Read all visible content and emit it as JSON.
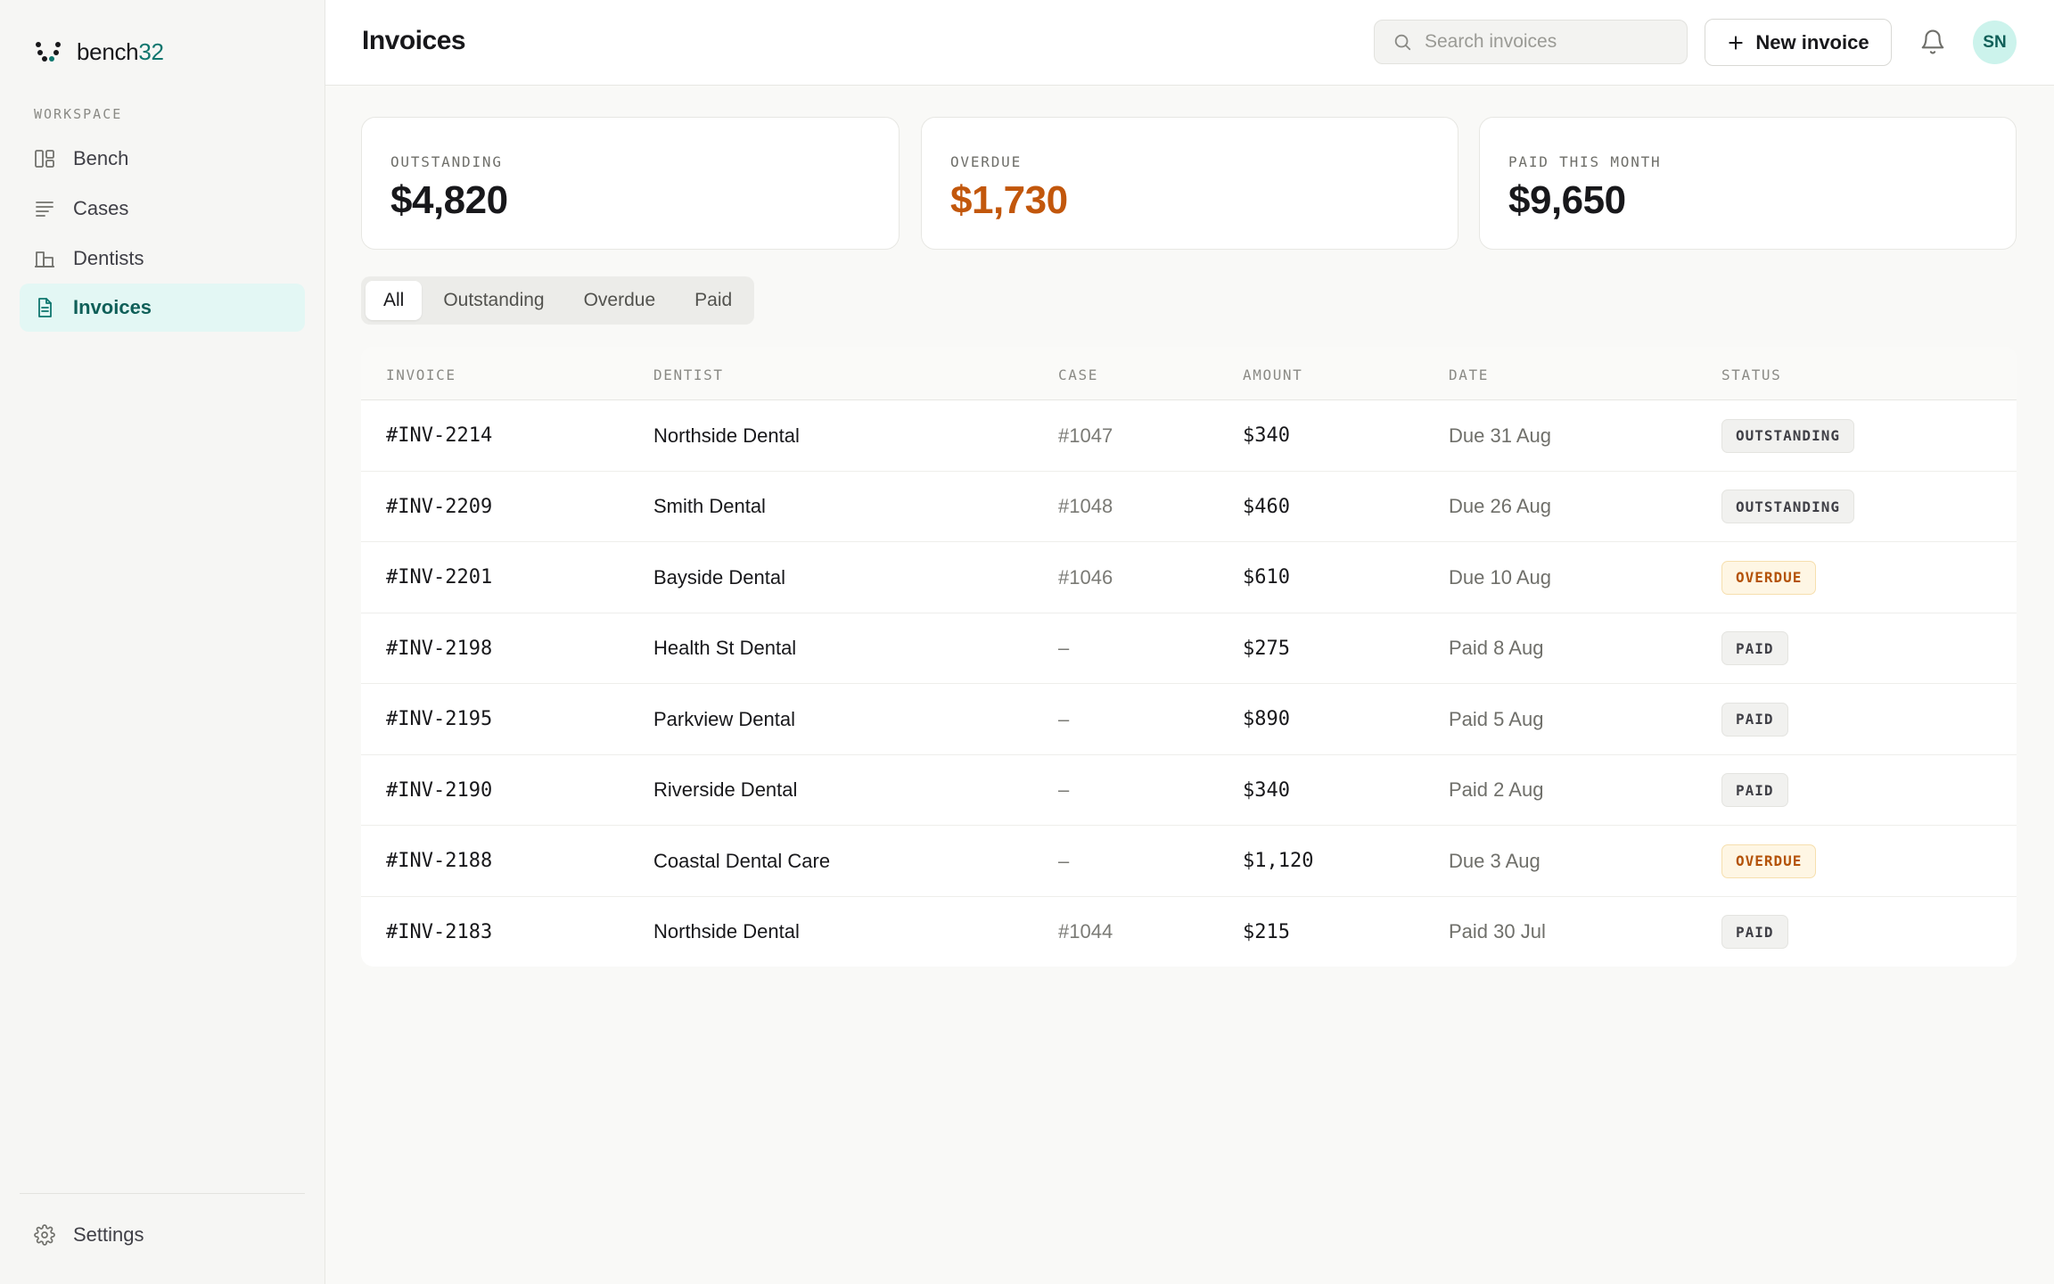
{
  "app": {
    "brand_prefix": "bench",
    "brand_suffix": "32"
  },
  "sidebar": {
    "section_label": "WORKSPACE",
    "items": [
      {
        "label": "Bench",
        "icon": "layout-grid-icon"
      },
      {
        "label": "Cases",
        "icon": "list-lines-icon"
      },
      {
        "label": "Dentists",
        "icon": "buildings-icon"
      },
      {
        "label": "Invoices",
        "icon": "document-icon",
        "active": true
      }
    ],
    "settings_label": "Settings"
  },
  "header": {
    "title": "Invoices",
    "search_placeholder": "Search invoices",
    "new_button_label": "New invoice",
    "avatar_initials": "SN"
  },
  "stats": [
    {
      "label": "OUTSTANDING",
      "value": "$4,820"
    },
    {
      "label": "OVERDUE",
      "value": "$1,730"
    },
    {
      "label": "PAID THIS MONTH",
      "value": "$9,650"
    }
  ],
  "filters": {
    "tabs": [
      "All",
      "Outstanding",
      "Overdue",
      "Paid"
    ],
    "active": "All"
  },
  "table": {
    "columns": [
      "INVOICE",
      "DENTIST",
      "CASE",
      "AMOUNT",
      "DATE",
      "STATUS"
    ],
    "rows": [
      {
        "invoice": "#INV-2214",
        "dentist": "Northside Dental",
        "case": "#1047",
        "amount": "$340",
        "date": "Due 31 Aug",
        "status": "OUTSTANDING"
      },
      {
        "invoice": "#INV-2209",
        "dentist": "Smith Dental",
        "case": "#1048",
        "amount": "$460",
        "date": "Due 26 Aug",
        "status": "OUTSTANDING"
      },
      {
        "invoice": "#INV-2201",
        "dentist": "Bayside Dental",
        "case": "#1046",
        "amount": "$610",
        "date": "Due 10 Aug",
        "status": "OVERDUE"
      },
      {
        "invoice": "#INV-2198",
        "dentist": "Health St Dental",
        "case": "–",
        "amount": "$275",
        "date": "Paid 8 Aug",
        "status": "PAID"
      },
      {
        "invoice": "#INV-2195",
        "dentist": "Parkview Dental",
        "case": "–",
        "amount": "$890",
        "date": "Paid 5 Aug",
        "status": "PAID"
      },
      {
        "invoice": "#INV-2190",
        "dentist": "Riverside Dental",
        "case": "–",
        "amount": "$340",
        "date": "Paid 2 Aug",
        "status": "PAID"
      },
      {
        "invoice": "#INV-2188",
        "dentist": "Coastal Dental Care",
        "case": "–",
        "amount": "$1,120",
        "date": "Due 3 Aug",
        "status": "OVERDUE"
      },
      {
        "invoice": "#INV-2183",
        "dentist": "Northside Dental",
        "case": "#1044",
        "amount": "$215",
        "date": "Paid 30 Jul",
        "status": "PAID"
      }
    ]
  },
  "colors": {
    "accent": "#0f766e",
    "overdue": "#c2570c",
    "active_nav_bg": "#e3f7f4"
  }
}
